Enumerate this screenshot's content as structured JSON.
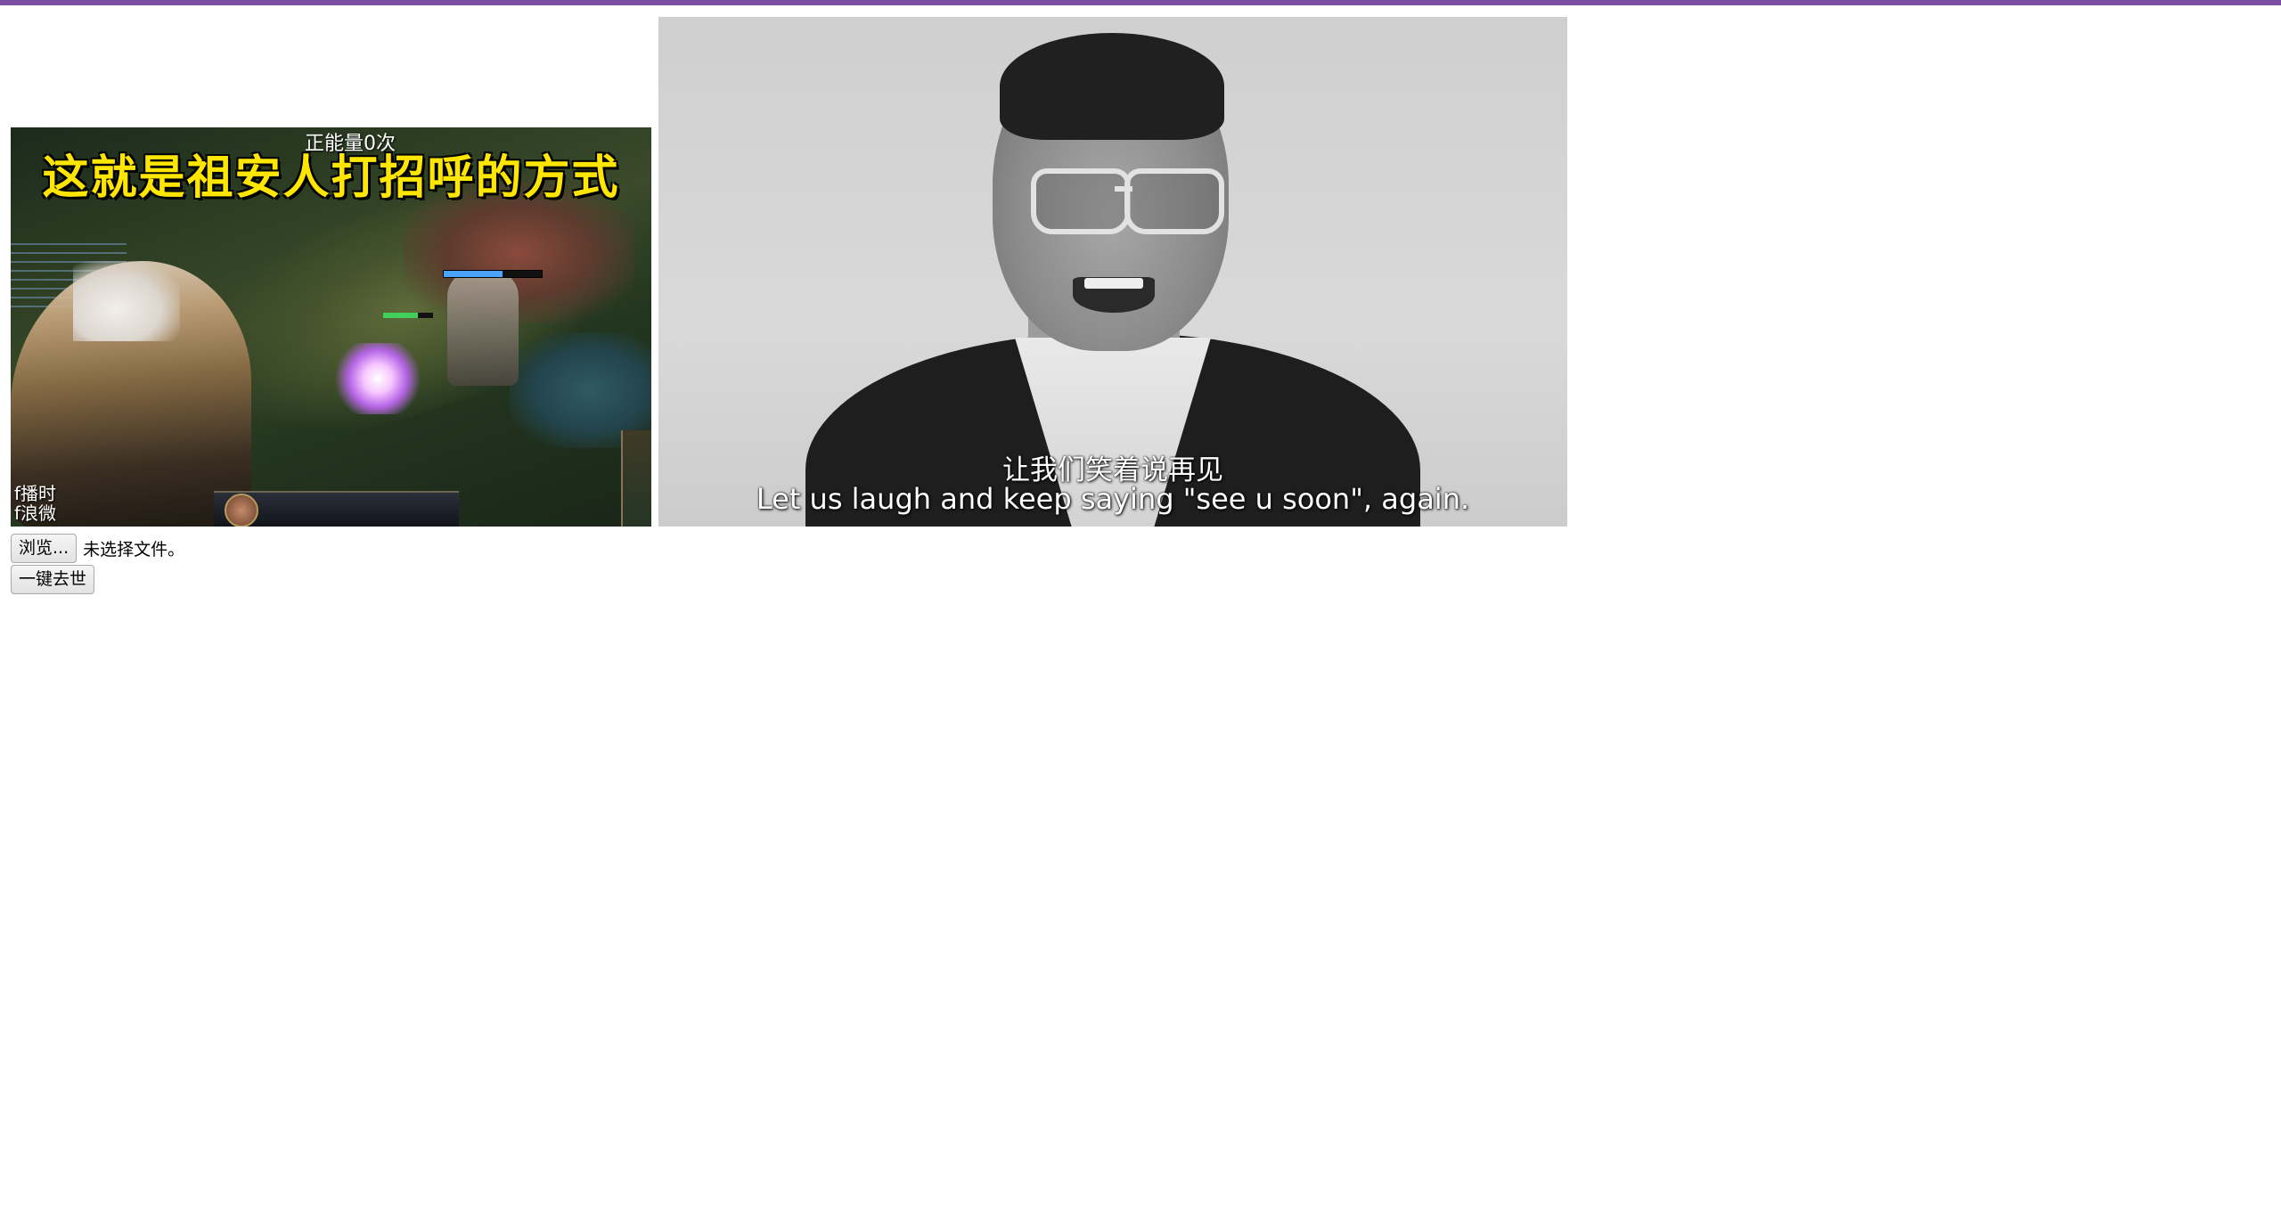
{
  "header": {
    "accent_color": "#7a4fa3"
  },
  "images": {
    "left": {
      "banner_text": "这就是祖安人打招呼的方式",
      "energy_text": "正能量0次",
      "watermark_text": "f播时\nf浪微",
      "hp_bar_ally_fraction": 0.7,
      "hp_bar_enemy_fraction": 0.6,
      "banner_color": "#ffe600"
    },
    "right": {
      "subtitle_cn": "让我们笑着说再见",
      "subtitle_en": "Let us laugh and keep saying \"see u soon\", again."
    }
  },
  "controls": {
    "browse_label": "浏览...",
    "file_status": "未选择文件。",
    "action_label": "一键去世"
  }
}
